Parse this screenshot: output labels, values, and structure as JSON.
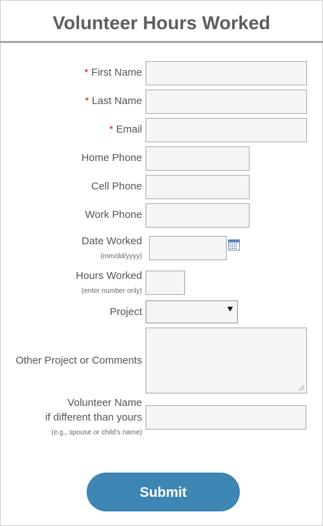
{
  "form": {
    "title": "Volunteer Hours Worked",
    "required_marker": "*",
    "fields": {
      "first_name": {
        "label": "First Name",
        "value": ""
      },
      "last_name": {
        "label": "Last Name",
        "value": ""
      },
      "email": {
        "label": "Email",
        "value": ""
      },
      "home_phone": {
        "label": "Home Phone",
        "value": ""
      },
      "cell_phone": {
        "label": "Cell Phone",
        "value": ""
      },
      "work_phone": {
        "label": "Work Phone",
        "value": ""
      },
      "date_worked": {
        "label": "Date Worked",
        "hint": "(mm/dd/yyyy)",
        "value": ""
      },
      "hours_worked": {
        "label": "Hours Worked",
        "hint": "(enter number only)",
        "value": ""
      },
      "project": {
        "label": "Project",
        "selected": ""
      },
      "other_project": {
        "label": "Other Project or Comments",
        "value": ""
      },
      "volunteer_name": {
        "label_line1": "Volunteer Name",
        "label_line2": "if different than yours",
        "hint": "(e.g., spouse or child's name)",
        "value": ""
      }
    },
    "submit_label": "Submit"
  },
  "icons": {
    "date_picker": "calendar-icon",
    "dropdown": "chevron-down-icon"
  },
  "colors": {
    "required": "#e02020",
    "submit_bg": "#3d85b2",
    "title": "#5d5d5d",
    "divider": "#a9a9a9"
  }
}
